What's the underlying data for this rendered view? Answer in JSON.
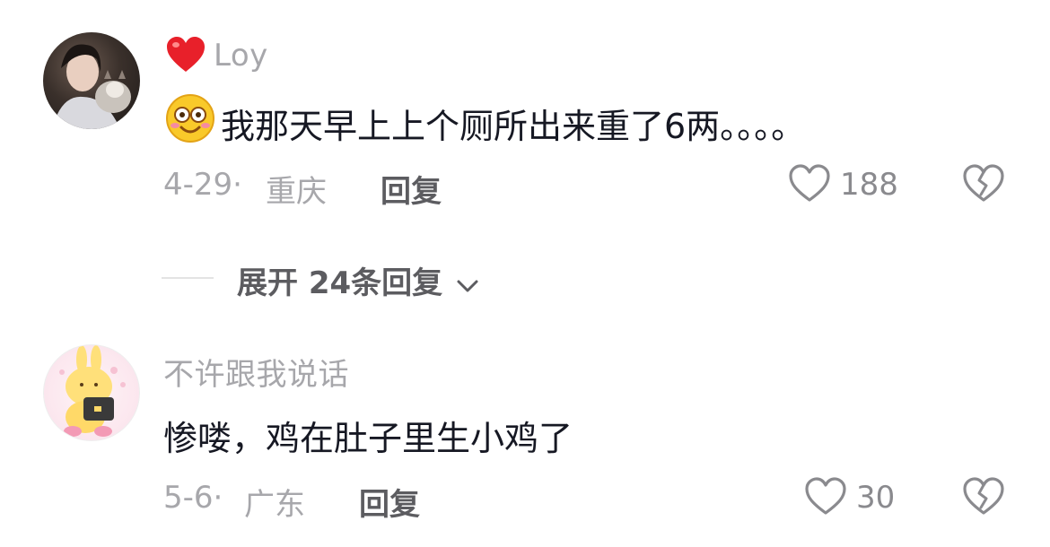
{
  "comments": [
    {
      "username": "Loy",
      "text": "我那天早上上个厕所出来重了6两。。。。",
      "date": "4-29·",
      "location": "重庆",
      "reply_label": "回复",
      "likes": "188",
      "username_prefix_icon": "red-heart-icon",
      "text_prefix_icon": "smiling-emoji-icon"
    },
    {
      "username": "不许跟我说话",
      "text": "惨喽，鸡在肚子里生小鸡了",
      "date": "5-6·",
      "location": "广东",
      "reply_label": "回复",
      "likes": "30"
    }
  ],
  "expand_replies": {
    "label": "展开 24条回复",
    "icon": "chevron-down-icon"
  },
  "colors": {
    "heart_red": "#e8202a",
    "meta_gray": "#a7a7ab",
    "text_dark": "#161823"
  }
}
